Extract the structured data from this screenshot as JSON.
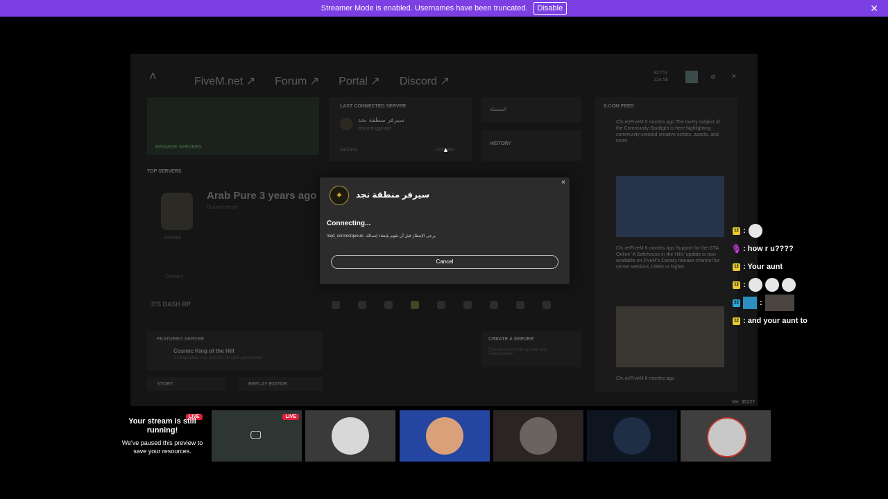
{
  "banner": {
    "message": "Streamer Mode is enabled. Usernames have been truncated.",
    "disable_label": "Disable",
    "close_glyph": "✕"
  },
  "game": {
    "logo_glyph": "Λ",
    "nav": [
      "FiveM.net ↗",
      "Forum ↗",
      "Portal ↗",
      "Discord ↗"
    ],
    "stats": [
      "32776",
      "224.5k"
    ],
    "browse_label": "BROWSE SERVERS",
    "last_connected_label": "LAST CONNECTED SERVER",
    "last_server_name": "سيرفر منطقة نجد",
    "last_server_sub": "discord.gg/najd",
    "last_server_players": "180/300",
    "connect_label": "Connect",
    "ar_panel_label": "المفضلة",
    "history_label": "HISTORY",
    "feed_label": "X.COM FEED",
    "feed_items": [
      "Cfx.re/FiveM\n5 months ago\nThe lovely subject of the Community Spotlight is here highlighting community-created creative scripts, assets, and more.",
      "Cfx.re/FiveM\n6 months ago\nSupport for the GTA Online 'A Safehouse in the Hills' update is now available on FiveM's Canary release channel for server versions 13983 or higher.",
      "Cfx.re/FiveM\n8 months ago"
    ],
    "top_servers_label": "TOP SERVERS",
    "top_server_name": "Arab Pure 3 years ago",
    "top_server_sub": "Discord server",
    "top_server_players": "195/560",
    "top_server_connect": "Connect",
    "dash_label": "ITS DASH RP",
    "featured_label": "FEATURED SERVER",
    "featured_name": "Cosmic King of the Hill",
    "featured_desc": "A competitive, non-stop KOTH style gamemode.",
    "create_label": "CREATE A SERVER",
    "create_desc": "Find out how to set up your own FiveM server!",
    "story_label": "STORY",
    "replay_label": "REPLAY EDITOR",
    "version": "Ver. 35227"
  },
  "modal": {
    "server_name": "سيرفر منطقة نجد",
    "status": "Connecting...",
    "queue_message": "najd_connectqueue: يرجى الإنتظار قبل أن تقوم بإنشاء إتصالك",
    "cancel_label": "Cancel",
    "close_glyph": "×"
  },
  "chat": [
    {
      "badge": "12",
      "text": ":"
    },
    {
      "badge": "mic",
      "text": ": how r u????"
    },
    {
      "badge": "12",
      "text": ": Your aunt"
    },
    {
      "badge": "12",
      "text": ":"
    },
    {
      "badge": "23",
      "text": ":"
    },
    {
      "badge": "12",
      "text": ": and your aunt to"
    }
  ],
  "stream": {
    "live_label": "LIVE",
    "title": "Your stream is still running!",
    "desc": "We've paused this preview to save your resources."
  },
  "colors": {
    "banner": "#7b3fe4",
    "live": "#e11f3a",
    "badge_gold": "#e8c834"
  }
}
